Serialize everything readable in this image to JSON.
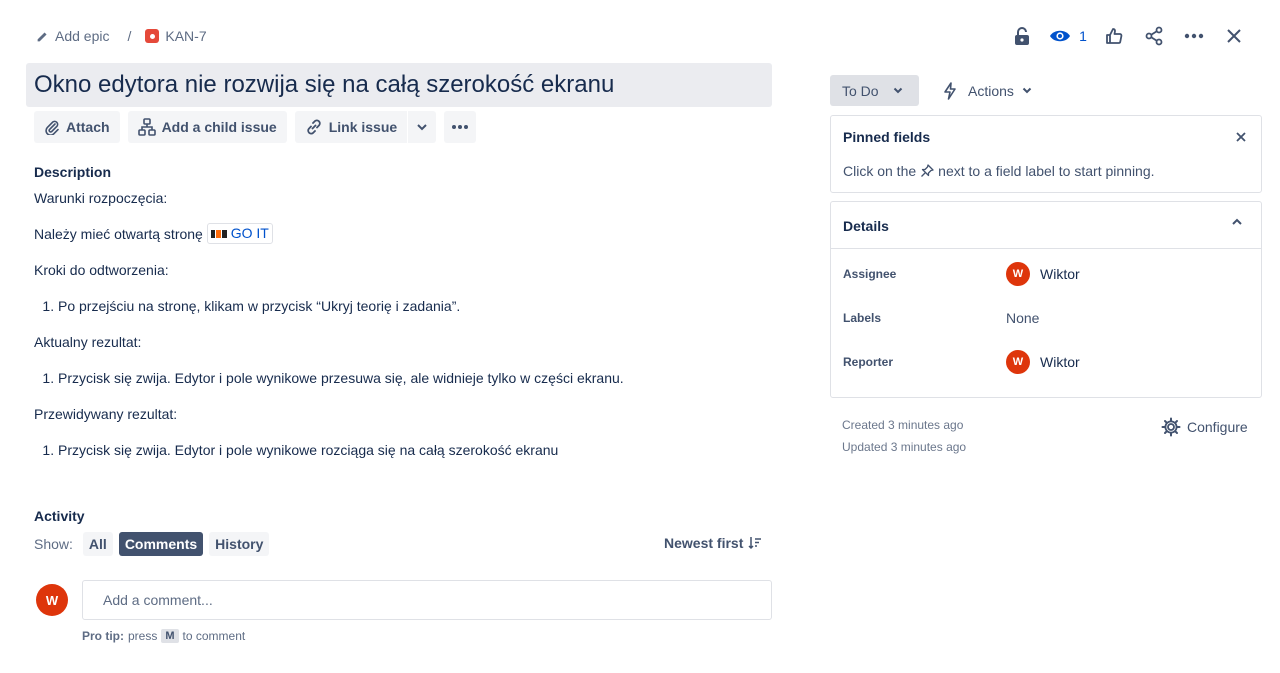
{
  "breadcrumb": {
    "add_epic": "Add epic",
    "separator": "/",
    "issue_key": "KAN-7"
  },
  "topbar": {
    "watch_count": "1",
    "icons": [
      "lock-icon",
      "eye-icon",
      "thumbs-up-icon",
      "share-icon",
      "more-icon",
      "close-icon"
    ]
  },
  "issue": {
    "title": "Okno edytora nie rozwija się na całą szerokość ekranu"
  },
  "toolbar": {
    "attach": "Attach",
    "add_child": "Add a child issue",
    "link_issue": "Link issue"
  },
  "description": {
    "heading": "Description",
    "start_conditions": "Warunki rozpoczęcia:",
    "need_page": "Należy mieć otwartą stronę",
    "link_label": "GO IT",
    "steps_heading": "Kroki do odtworzenia:",
    "step_1": "Po przejściu na stronę, klikam w przycisk “Ukryj teorię i zadania”.",
    "actual_heading": "Aktualny rezultat:",
    "actual_1": "Przycisk się zwija. Edytor i pole wynikowe przesuwa się, ale widnieje tylko w części ekranu.",
    "expected_heading": "Przewidywany rezultat:",
    "expected_1": "Przycisk się zwija. Edytor i pole wynikowe rozciąga się na całą szerokość ekranu"
  },
  "activity": {
    "heading": "Activity",
    "show_label": "Show:",
    "filters": [
      "All",
      "Comments",
      "History"
    ],
    "active_filter": "Comments",
    "sort": "Newest first",
    "avatar_initial": "W",
    "comment_placeholder": "Add a comment...",
    "protip_bold": "Pro tip:",
    "protip_press": "press",
    "protip_key": "M",
    "protip_rest": "to comment"
  },
  "side": {
    "status": "To Do",
    "actions": "Actions",
    "pinned": {
      "heading": "Pinned fields",
      "text_before": "Click on the",
      "text_after": "next to a field label to start pinning."
    },
    "details": {
      "heading": "Details",
      "assignee_label": "Assignee",
      "assignee_value": "Wiktor",
      "labels_label": "Labels",
      "labels_value": "None",
      "reporter_label": "Reporter",
      "reporter_value": "Wiktor",
      "avatar_initial": "W"
    },
    "created": "Created 3 minutes ago",
    "updated": "Updated 3 minutes ago",
    "configure": "Configure"
  },
  "colors": {
    "avatar": "#de350b",
    "issue_type": "#e5493a",
    "link": "#0052cc",
    "active_chip": "#42526e"
  }
}
